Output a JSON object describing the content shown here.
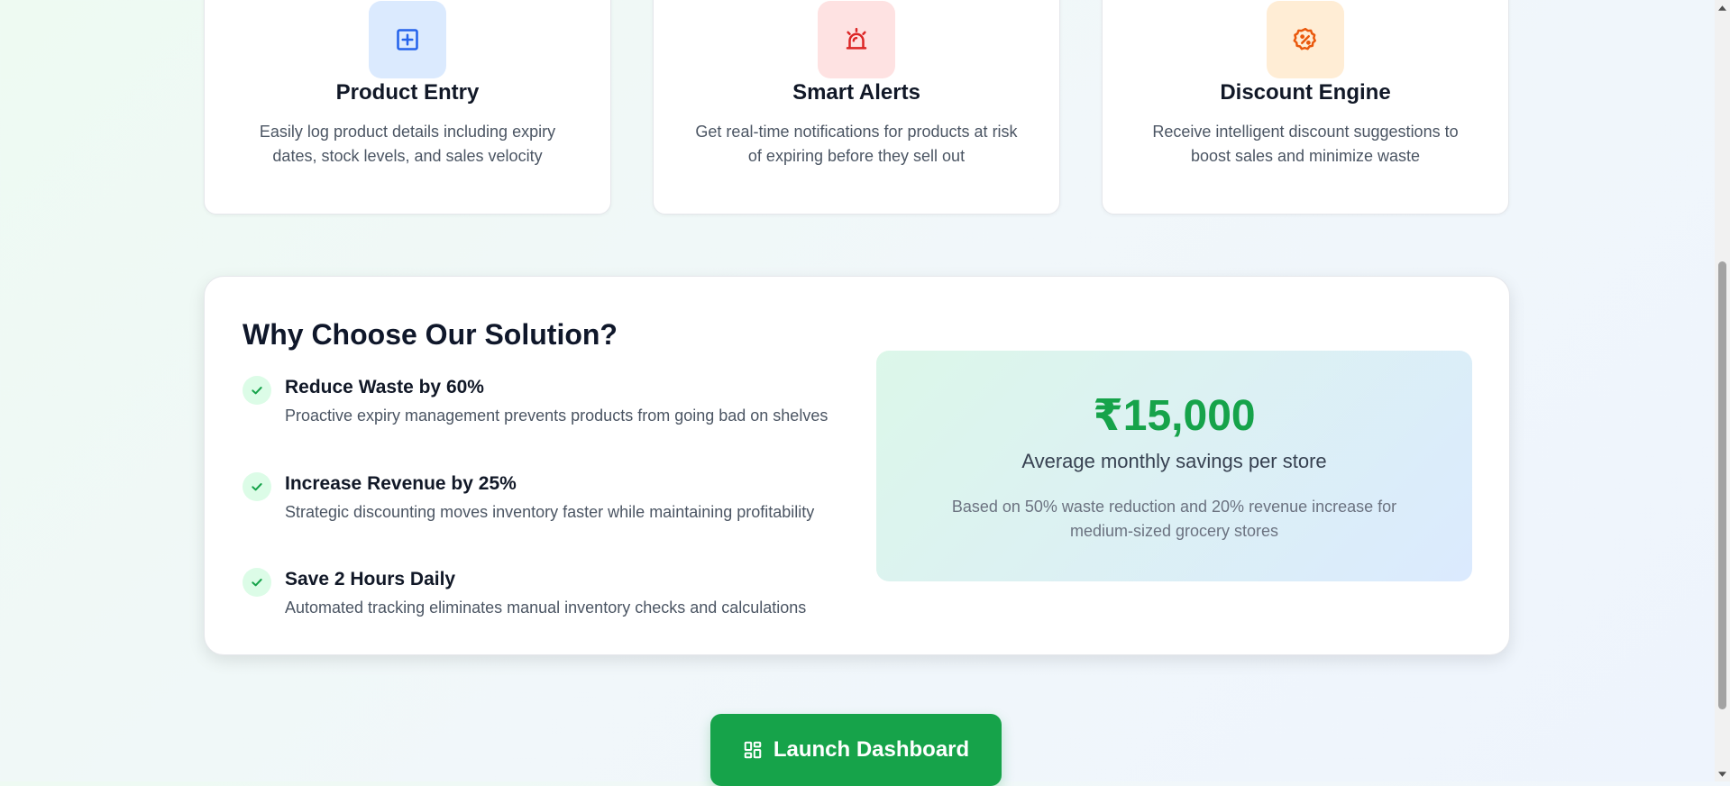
{
  "features": [
    {
      "icon": "plus-square-icon",
      "title": "Product Entry",
      "description": "Easily log product details including expiry dates, stock levels, and sales velocity",
      "icon_bg": "#dbeafe",
      "icon_color": "#2563eb"
    },
    {
      "icon": "alarm-siren-icon",
      "title": "Smart Alerts",
      "description": "Get real-time notifications for products at risk of expiring before they sell out",
      "icon_bg": "#fee2e2",
      "icon_color": "#dc2626"
    },
    {
      "icon": "discount-badge-icon",
      "title": "Discount Engine",
      "description": "Receive intelligent discount suggestions to boost sales and minimize waste",
      "icon_bg": "#ffedd5",
      "icon_color": "#ea580c"
    }
  ],
  "why": {
    "title": "Why Choose Our Solution?",
    "benefits": [
      {
        "title": "Reduce Waste by 60%",
        "description": "Proactive expiry management prevents products from going bad on shelves"
      },
      {
        "title": "Increase Revenue by 25%",
        "description": "Strategic discounting moves inventory faster while maintaining profitability"
      },
      {
        "title": "Save 2 Hours Daily",
        "description": "Automated tracking eliminates manual inventory checks and calculations"
      }
    ],
    "savings": {
      "amount": "₹15,000",
      "label": "Average monthly savings per store",
      "note": "Based on 50% waste reduction and 20% revenue increase for medium-sized grocery stores"
    }
  },
  "cta": {
    "label": "Launch Dashboard",
    "icon": "dashboard-grid-icon",
    "color": "#16a34a"
  }
}
